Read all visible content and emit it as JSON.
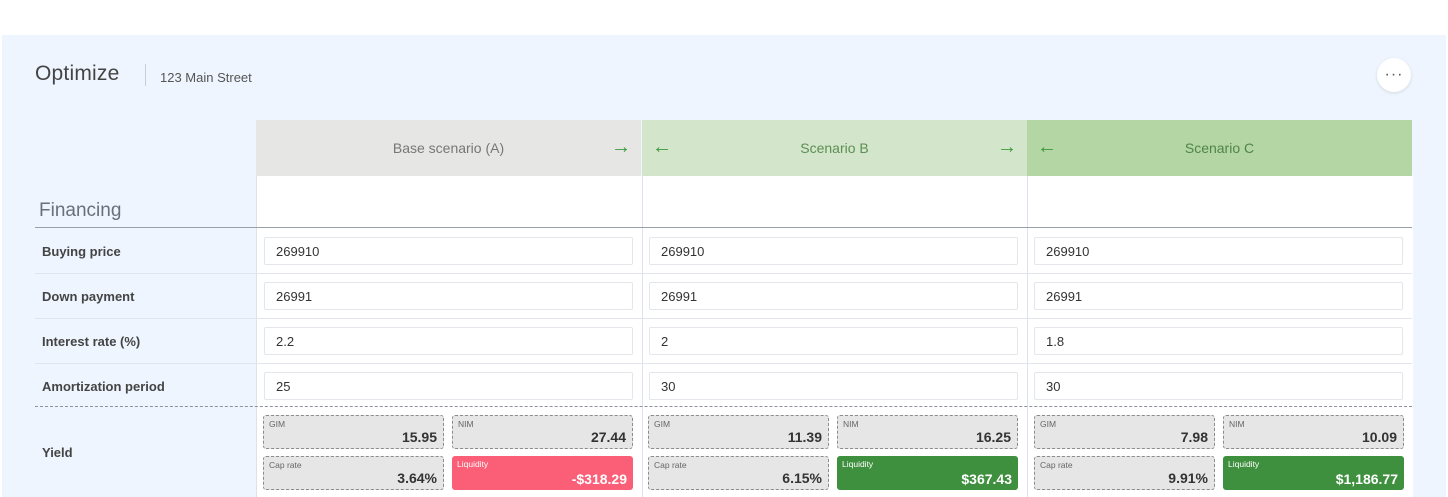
{
  "header": {
    "title": "Optimize",
    "subtitle": "123 Main Street",
    "more_label": "···"
  },
  "section_title": "Financing",
  "scenarios": [
    {
      "name": "Base scenario (A)",
      "left_arrow": "",
      "right_arrow": "→"
    },
    {
      "name": "Scenario B",
      "left_arrow": "←",
      "right_arrow": "→"
    },
    {
      "name": "Scenario C",
      "left_arrow": "←",
      "right_arrow": ""
    }
  ],
  "rows": {
    "buying_price": {
      "label": "Buying price",
      "values": [
        "269910",
        "269910",
        "269910"
      ]
    },
    "down_payment": {
      "label": "Down payment",
      "values": [
        "26991",
        "26991",
        "26991"
      ]
    },
    "interest_rate": {
      "label": "Interest rate (%)",
      "values": [
        "2.2",
        "2",
        "1.8"
      ]
    },
    "amortization": {
      "label": "Amortization period",
      "values": [
        "25",
        "30",
        "30"
      ]
    }
  },
  "yield": {
    "label": "Yield",
    "metric_labels": {
      "gim": "GIM",
      "nim": "NIM",
      "cap": "Cap rate",
      "liquidity": "Liquidity"
    },
    "scenarios": [
      {
        "gim": "15.95",
        "nim": "27.44",
        "cap": "3.64%",
        "liquidity": "-$318.29",
        "liquidity_status": "negative"
      },
      {
        "gim": "11.39",
        "nim": "16.25",
        "cap": "6.15%",
        "liquidity": "$367.43",
        "liquidity_status": "positive"
      },
      {
        "gim": "7.98",
        "nim": "10.09",
        "cap": "9.91%",
        "liquidity": "$1,186.77",
        "liquidity_status": "positive"
      }
    ]
  },
  "colors": {
    "negative": "#fb5e77",
    "positive": "#3e8f3e",
    "arrow": "#3d9a3d"
  },
  "icons": {
    "left_arrow": "arrow-left-icon",
    "right_arrow": "arrow-right-icon",
    "more": "more-dots-icon"
  }
}
